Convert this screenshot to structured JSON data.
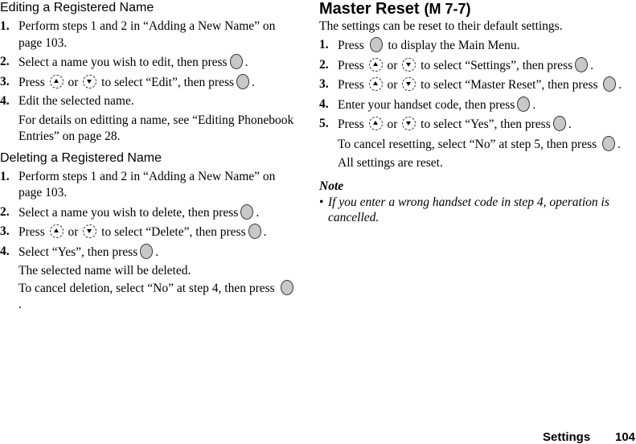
{
  "left": {
    "editing": {
      "heading": "Editing a Registered Name",
      "steps": [
        {
          "num": "1.",
          "text": "Perform steps 1 and 2 in “Adding a New Name” on page 103."
        },
        {
          "num": "2.",
          "before": "Select a name you wish to edit, then press",
          "after": "."
        },
        {
          "num": "3.",
          "a": "Press",
          "or": "or",
          "b": "to select “Edit”, then press",
          "after": "."
        },
        {
          "num": "4.",
          "text": "Edit the selected name.",
          "extra": "For details on editting a name, see “Editing Phonebook Entries” on page 28."
        }
      ]
    },
    "deleting": {
      "heading": "Deleting a Registered Name",
      "steps": [
        {
          "num": "1.",
          "text": "Perform steps 1 and 2 in “Adding a New Name” on page 103."
        },
        {
          "num": "2.",
          "before": "Select a name you wish to delete, then press",
          "after": "."
        },
        {
          "num": "3.",
          "a": "Press",
          "or": "or",
          "b": "to select “Delete”, then press",
          "after": "."
        },
        {
          "num": "4.",
          "before": "Select “Yes”, then press",
          "after": ".",
          "extra1": "The selected name will be deleted.",
          "extra2": "To cancel deletion, select “No” at step 4, then press",
          "extra2_after": "."
        }
      ]
    }
  },
  "right": {
    "heading": "Master Reset",
    "menu_code": "(M 7-7)",
    "intro": "The settings can be reset to their default settings.",
    "steps": [
      {
        "num": "1.",
        "a": "Press",
        "b": "to display the Main Menu."
      },
      {
        "num": "2.",
        "a": "Press",
        "or": "or",
        "b": "to select “Settings”, then press",
        "after": "."
      },
      {
        "num": "3.",
        "a": "Press",
        "or": "or",
        "b": "to select “Master Reset”, then press",
        "after": "."
      },
      {
        "num": "4.",
        "before": "Enter your handset code, then press",
        "after": "."
      },
      {
        "num": "5.",
        "a": "Press",
        "or": "or",
        "b": "to select “Yes”, then press",
        "after": ".",
        "extra1": "To cancel resetting, select “No” at step 5, then press",
        "extra1_after": ".",
        "extra2": "All settings are reset."
      }
    ],
    "note": {
      "title": "Note",
      "bullet": "•",
      "items": [
        "If you enter a wrong handset code in step 4, operation is cancelled."
      ]
    }
  },
  "footer": {
    "section": "Settings",
    "page": "104"
  },
  "icons": {
    "center_key": "center-key-icon",
    "nav_up": "nav-up-icon",
    "nav_down": "nav-down-icon"
  }
}
